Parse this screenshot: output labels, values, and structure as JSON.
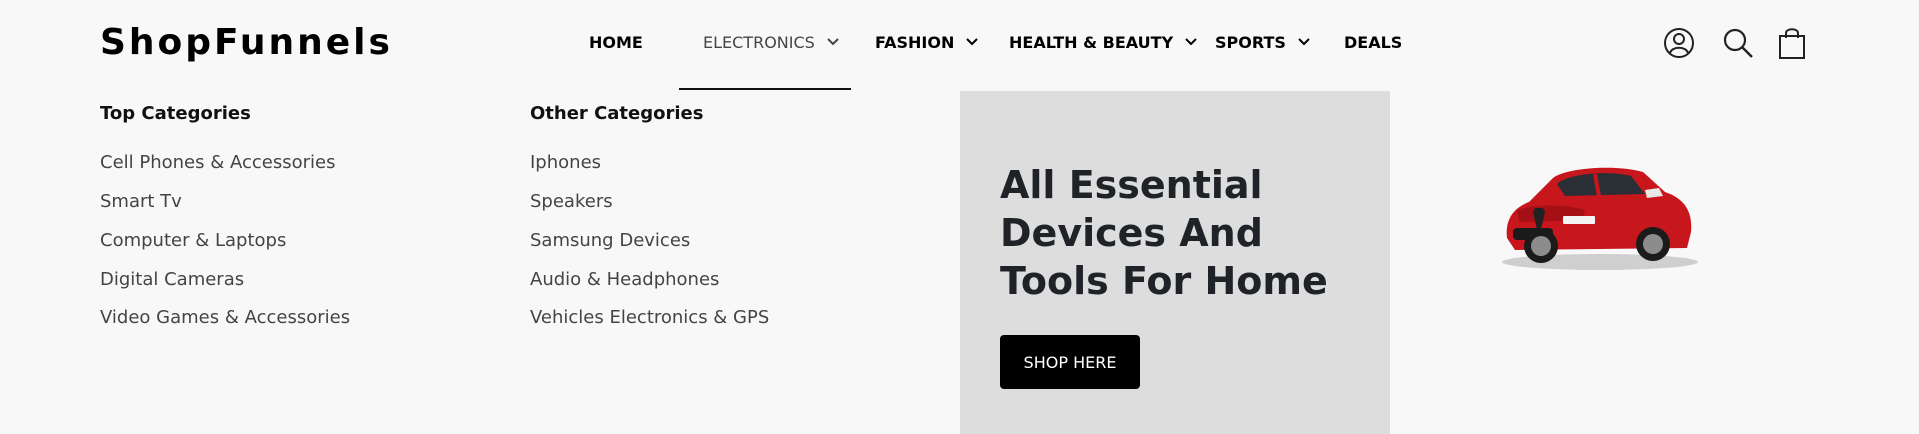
{
  "brand": {
    "logo": "ShopFunnels"
  },
  "nav": {
    "items": [
      {
        "label": "HOME",
        "dropdown": false
      },
      {
        "label": "ELECTRONICS",
        "dropdown": true,
        "active": true
      },
      {
        "label": "FASHION",
        "dropdown": true
      },
      {
        "label": "HEALTH & BEAUTY",
        "dropdown": true
      },
      {
        "label": "SPORTS",
        "dropdown": true
      },
      {
        "label": "DEALS",
        "dropdown": false
      }
    ]
  },
  "header_icons": [
    "account-icon",
    "search-icon",
    "shopping-bag-icon"
  ],
  "mega_menu": {
    "top_categories": {
      "title": "Top Categories",
      "links": [
        "Cell Phones & Accessories",
        "Smart Tv",
        "Computer & Laptops",
        "Digital Cameras",
        "Video Games & Accessories"
      ]
    },
    "other_categories": {
      "title": "Other Categories",
      "links": [
        "Iphones",
        "Speakers",
        "Samsung Devices",
        "Audio & Headphones",
        "Vehicles Electronics & GPS"
      ]
    },
    "promo": {
      "heading": "All Essential Devices And Tools For Home",
      "button": "SHOP HERE",
      "background": "#dddddd"
    }
  },
  "colors": {
    "accent": "#000000",
    "page_bg": "#f8f8f8",
    "car_red": "#c8161d"
  }
}
